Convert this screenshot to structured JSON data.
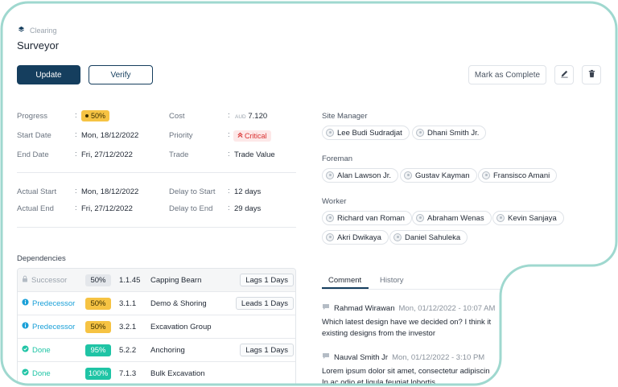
{
  "breadcrumb": {
    "label": "Clearing"
  },
  "page": {
    "title": "Surveyor"
  },
  "toolbar": {
    "update_label": "Update",
    "verify_label": "Verify",
    "complete_label": "Mark as Complete"
  },
  "fields": {
    "progress_label": "Progress",
    "progress_value": "50%",
    "start_date_label": "Start Date",
    "start_date_value": "Mon, 18/12/2022",
    "end_date_label": "End Date",
    "end_date_value": "Fri, 27/12/2022",
    "cost_label": "Cost",
    "cost_currency": "AUD",
    "cost_value": "7.120",
    "priority_label": "Priority",
    "priority_value": "Critical",
    "trade_label": "Trade",
    "trade_value": "Trade Value",
    "actual_start_label": "Actual Start",
    "actual_start_value": "Mon, 18/12/2022",
    "actual_end_label": "Actual End",
    "actual_end_value": "Fri, 27/12/2022",
    "delay_start_label": "Delay to Start",
    "delay_start_value": "12 days",
    "delay_end_label": "Delay to End",
    "delay_end_value": "29 days",
    "colon": ":"
  },
  "people": {
    "site_manager_label": "Site Manager",
    "site_managers": [
      "Lee Budi Sudradjat",
      "Dhani Smith Jr."
    ],
    "foreman_label": "Foreman",
    "foremen": [
      "Alan Lawson Jr.",
      "Gustav Kayman",
      "Fransisco Amani"
    ],
    "worker_label": "Worker",
    "workers": [
      "Richard van Roman",
      "Abraham Wenas",
      "Kevin Sanjaya",
      "Akri Dwikaya",
      "Daniel Sahuleka"
    ]
  },
  "dependencies": {
    "title": "Dependencies",
    "rows": [
      {
        "type": "Successor",
        "pct": "50%",
        "code": "1.1.45",
        "name": "Capping Bearn",
        "lag": "Lags 1 Days"
      },
      {
        "type": "Predecessor",
        "pct": "50%",
        "code": "3.1.1",
        "name": "Demo & Shoring",
        "lag": "Leads 1 Days"
      },
      {
        "type": "Predecessor",
        "pct": "50%",
        "code": "3.2.1",
        "name": "Excavation Group",
        "lag": ""
      },
      {
        "type": "Done",
        "pct": "95%",
        "code": "5.2.2",
        "name": "Anchoring",
        "lag": "Lags 1 Days"
      },
      {
        "type": "Done",
        "pct": "100%",
        "code": "7.1.3",
        "name": "Bulk Excavation",
        "lag": ""
      }
    ]
  },
  "tabs": {
    "comment": "Comment",
    "history": "History"
  },
  "comments": [
    {
      "author": "Rahmad Wirawan",
      "time": "Mon, 01/12/2022 - 10:07 AM",
      "line1": "Which latest design have we decided on? I think it",
      "line2": "existing designs from the investor"
    },
    {
      "author": "Nauval Smith Jr",
      "time": "Mon, 01/12/2022 - 3:10 PM",
      "line1": "Lorem ipsum dolor sit amet, consectetur adipiscin",
      "line2": "In ac odio et ligula feugiat lobortis"
    }
  ],
  "colors": {
    "primary": "#153e5e",
    "warning": "#f6c343",
    "success": "#1fc4a5",
    "info": "#1aa0d8",
    "danger": "#d93030",
    "frame_outline": "#9fd8cf"
  }
}
